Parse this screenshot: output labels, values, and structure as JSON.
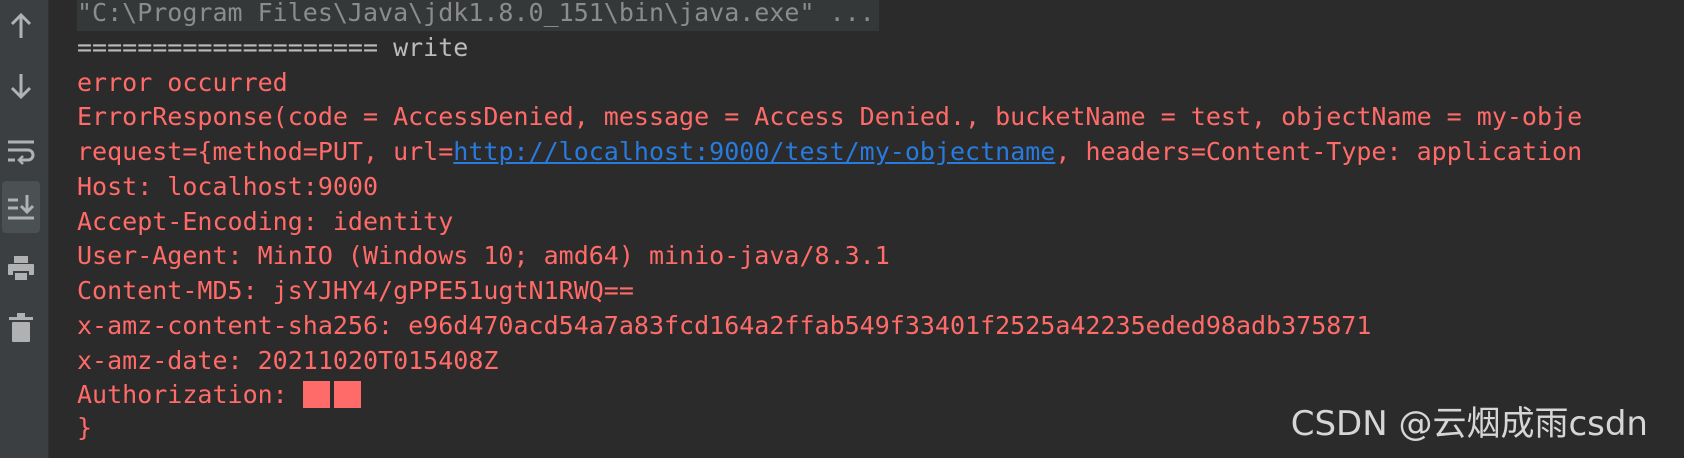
{
  "toolbar": {
    "buttons": [
      {
        "name": "up-arrow-icon",
        "active": false
      },
      {
        "name": "down-arrow-icon",
        "active": false
      },
      {
        "name": "soft-wrap-icon",
        "active": false
      },
      {
        "name": "scroll-to-end-icon",
        "active": true
      },
      {
        "name": "print-icon",
        "active": false
      },
      {
        "name": "trash-icon",
        "active": false
      }
    ]
  },
  "console": {
    "command": "\"C:\\Program Files\\Java\\jdk1.8.0_151\\bin\\java.exe\" ...",
    "separator": "==================== write",
    "error_title": "error occurred",
    "error_response": "ErrorResponse(code = AccessDenied, message = Access Denied., bucketName = test, objectName = my-obje",
    "request_prefix": "request={method=PUT, url=",
    "request_url": "http://localhost:9000/test/my-objectname",
    "request_suffix": ", headers=Content-Type: application",
    "host": "Host: localhost:9000",
    "accept_encoding": "Accept-Encoding: identity",
    "user_agent": "User-Agent: MinIO (Windows 10; amd64) minio-java/8.3.1",
    "content_md5": "Content-MD5: jsYJHY4/gPPE51ugtN1RWQ==",
    "sha256": "x-amz-content-sha256: e96d470acd54a7a83fcd164a2ffab549f33401f2525a42235eded98adb375871",
    "amz_date": "x-amz-date: 20211020T015408Z",
    "authorization": "Authorization: ",
    "closing": "}"
  },
  "watermark": "CSDN @云烟成雨csdn",
  "colors": {
    "background": "#2b2b2b",
    "toolbar": "#3c3f41",
    "error_text": "#ff6b68",
    "plain_text": "#bbbbbb",
    "command_text": "#8c8c8c",
    "link": "#287bde"
  }
}
